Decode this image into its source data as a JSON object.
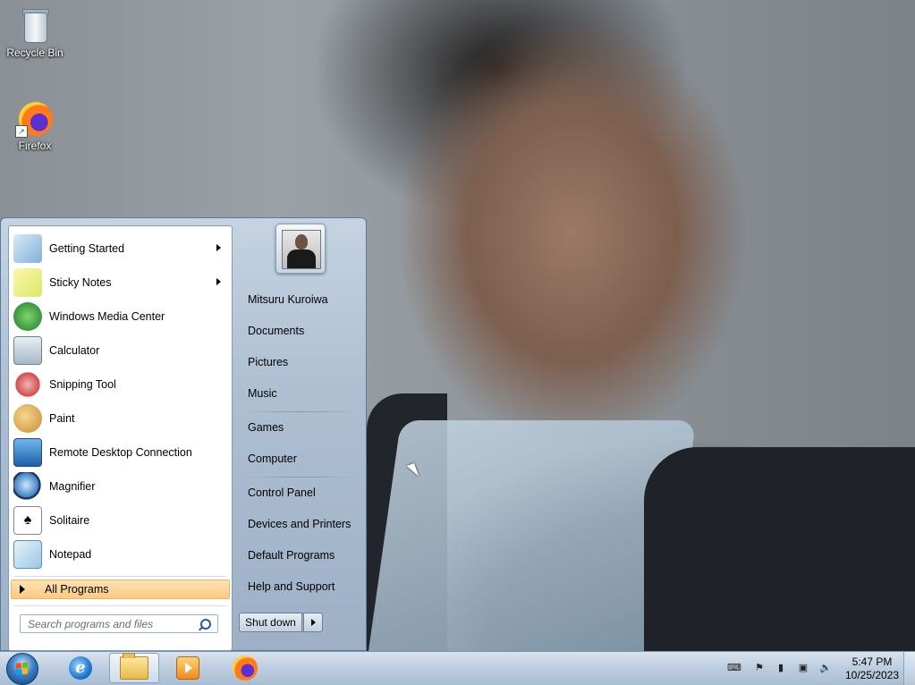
{
  "desktop": {
    "icons": [
      {
        "label": "Recycle Bin",
        "icon": "recycle-bin-icon"
      },
      {
        "label": "Firefox",
        "icon": "firefox-icon"
      }
    ]
  },
  "start_menu": {
    "programs": [
      {
        "label": "Getting Started",
        "icon": "getting-started-icon",
        "has_submenu": true
      },
      {
        "label": "Sticky Notes",
        "icon": "sticky-notes-icon",
        "has_submenu": true
      },
      {
        "label": "Windows Media Center",
        "icon": "windows-media-center-icon",
        "has_submenu": false
      },
      {
        "label": "Calculator",
        "icon": "calculator-icon",
        "has_submenu": false
      },
      {
        "label": "Snipping Tool",
        "icon": "snipping-tool-icon",
        "has_submenu": false
      },
      {
        "label": "Paint",
        "icon": "paint-icon",
        "has_submenu": false
      },
      {
        "label": "Remote Desktop Connection",
        "icon": "remote-desktop-icon",
        "has_submenu": false
      },
      {
        "label": "Magnifier",
        "icon": "magnifier-icon",
        "has_submenu": false
      },
      {
        "label": "Solitaire",
        "icon": "solitaire-icon",
        "has_submenu": false
      },
      {
        "label": "Notepad",
        "icon": "notepad-icon",
        "has_submenu": false
      }
    ],
    "all_programs_label": "All Programs",
    "search_placeholder": "Search programs and files",
    "right_items": [
      "Mitsuru Kuroiwa",
      "Documents",
      "Pictures",
      "Music",
      "Games",
      "Computer",
      "Control Panel",
      "Devices and Printers",
      "Default Programs",
      "Help and Support"
    ],
    "shutdown_label": "Shut down"
  },
  "taskbar": {
    "pinned": [
      {
        "icon": "internet-explorer-icon"
      },
      {
        "icon": "windows-explorer-icon"
      },
      {
        "icon": "windows-media-player-icon"
      },
      {
        "icon": "firefox-icon"
      }
    ],
    "clock_time": "5:47 PM",
    "clock_date": "10/25/2023",
    "tray_icons": [
      "keyboard-icon",
      "action-center-flag-icon",
      "power-icon",
      "network-icon",
      "volume-icon"
    ]
  }
}
